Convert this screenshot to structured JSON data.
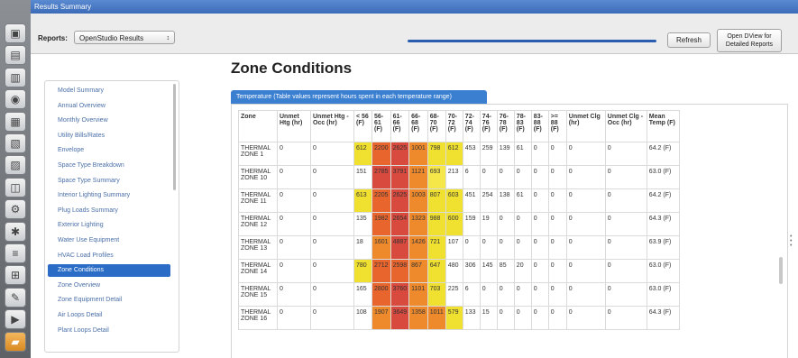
{
  "window": {
    "title": "Results Summary"
  },
  "toolbar_icons": [
    "building-icon",
    "schedule-icon",
    "constructions-icon",
    "loads-icon",
    "space-types-icon",
    "facility-icon",
    "spaces-icon",
    "thermal-zones-icon",
    "hvac-icon",
    "refrigeration-icon",
    "variables-icon",
    "simulation-settings-icon",
    "ruby-script-icon",
    "run-icon",
    "results-icon"
  ],
  "topbar": {
    "reports_label": "Reports:",
    "reports_value": "OpenStudio Results",
    "progress": 1.0,
    "refresh_label": "Refresh",
    "dview_label_1": "Open DView for",
    "dview_label_2": "Detailed Reports"
  },
  "page": {
    "title": "Zone Conditions",
    "tab": "Temperature (Table values represent hours spent in each temperature range)"
  },
  "sidebar": {
    "items": [
      "Model Summary",
      "Annual Overview",
      "Monthly Overview",
      "Utility Bills/Rates",
      "Envelope",
      "Space Type Breakdown",
      "Space Type Summary",
      "Interior Lighting Summary",
      "Plug Loads Summary",
      "Exterior Lighting",
      "Water Use Equipment",
      "HVAC Load Profiles",
      "Zone Conditions",
      "Zone Overview",
      "Zone Equipment Detail",
      "Air Loops Detail",
      "Plant Loops Detail"
    ],
    "active_index": 12
  },
  "table": {
    "headers": [
      "Zone",
      "Unmet Htg (hr)",
      "Unmet Htg - Occ (hr)",
      "< 56 (F)",
      "56-61 (F)",
      "61-66 (F)",
      "66-68 (F)",
      "68-70 (F)",
      "70-72 (F)",
      "72-74 (F)",
      "74-76 (F)",
      "76-78 (F)",
      "78-83 (F)",
      "83-88 (F)",
      ">= 88 (F)",
      "Unmet Clg (hr)",
      "Unmet Clg - Occ (hr)",
      "Mean Temp (F)"
    ],
    "rows": [
      [
        "THERMAL ZONE 1",
        "0",
        "0",
        "612",
        "2200",
        "2625",
        "1001",
        "798",
        "612",
        "453",
        "259",
        "139",
        "61",
        "0",
        "0",
        "0",
        "0",
        "64.2 (F)"
      ],
      [
        "THERMAL ZONE 10",
        "0",
        "0",
        "151",
        "2785",
        "3791",
        "1121",
        "693",
        "213",
        "6",
        "0",
        "0",
        "0",
        "0",
        "0",
        "0",
        "0",
        "63.0 (F)"
      ],
      [
        "THERMAL ZONE 11",
        "0",
        "0",
        "613",
        "2205",
        "2625",
        "1003",
        "807",
        "603",
        "451",
        "254",
        "138",
        "61",
        "0",
        "0",
        "0",
        "0",
        "64.2 (F)"
      ],
      [
        "THERMAL ZONE 12",
        "0",
        "0",
        "135",
        "1982",
        "2654",
        "1323",
        "988",
        "600",
        "159",
        "19",
        "0",
        "0",
        "0",
        "0",
        "0",
        "0",
        "64.3 (F)"
      ],
      [
        "THERMAL ZONE 13",
        "0",
        "0",
        "18",
        "1601",
        "4887",
        "1426",
        "721",
        "107",
        "0",
        "0",
        "0",
        "0",
        "0",
        "0",
        "0",
        "0",
        "63.9 (F)"
      ],
      [
        "THERMAL ZONE 14",
        "0",
        "0",
        "780",
        "2712",
        "2598",
        "867",
        "647",
        "480",
        "306",
        "145",
        "85",
        "20",
        "0",
        "0",
        "0",
        "0",
        "63.0 (F)"
      ],
      [
        "THERMAL ZONE 15",
        "0",
        "0",
        "165",
        "2800",
        "3760",
        "1101",
        "703",
        "225",
        "6",
        "0",
        "0",
        "0",
        "0",
        "0",
        "0",
        "0",
        "63.0 (F)"
      ],
      [
        "THERMAL ZONE 16",
        "0",
        "0",
        "108",
        "1907",
        "3649",
        "1358",
        "1011",
        "579",
        "133",
        "15",
        "0",
        "0",
        "0",
        "0",
        "0",
        "0",
        "64.3 (F)"
      ]
    ],
    "cell_colors": [
      [
        null,
        null,
        null,
        "#f0e030",
        "#e8652e",
        "#d84a3e",
        "#ee8a2c",
        "#f0e030",
        "#f0e030",
        null,
        null,
        null,
        null,
        null,
        null,
        null,
        null,
        null
      ],
      [
        null,
        null,
        null,
        null,
        "#d84a3e",
        "#d84a3e",
        "#ee8a2c",
        "#f5e64a",
        null,
        null,
        null,
        null,
        null,
        null,
        null,
        null,
        null,
        null
      ],
      [
        null,
        null,
        null,
        "#f0e030",
        "#e8652e",
        "#d84a3e",
        "#ee8a2c",
        "#f0e030",
        "#f0e030",
        null,
        null,
        null,
        null,
        null,
        null,
        null,
        null,
        null
      ],
      [
        null,
        null,
        null,
        null,
        "#e8652e",
        "#d84a3e",
        "#ee8a2c",
        "#f0e030",
        "#f0e030",
        null,
        null,
        null,
        null,
        null,
        null,
        null,
        null,
        null
      ],
      [
        null,
        null,
        null,
        null,
        "#ee8a2c",
        "#d84a3e",
        "#ee8a2c",
        "#f0e030",
        null,
        null,
        null,
        null,
        null,
        null,
        null,
        null,
        null,
        null
      ],
      [
        null,
        null,
        null,
        "#f0e030",
        "#e8652e",
        "#e8652e",
        "#ee8a2c",
        "#f0e030",
        null,
        null,
        null,
        null,
        null,
        null,
        null,
        null,
        null,
        null
      ],
      [
        null,
        null,
        null,
        null,
        "#e8652e",
        "#d84a3e",
        "#ee8a2c",
        "#f0e030",
        null,
        null,
        null,
        null,
        null,
        null,
        null,
        null,
        null,
        null
      ],
      [
        null,
        null,
        null,
        null,
        "#ee8a2c",
        "#d84a3e",
        "#ee8a2c",
        "#ee8a2c",
        "#f0e030",
        null,
        null,
        null,
        null,
        null,
        null,
        null,
        null,
        null
      ]
    ]
  }
}
